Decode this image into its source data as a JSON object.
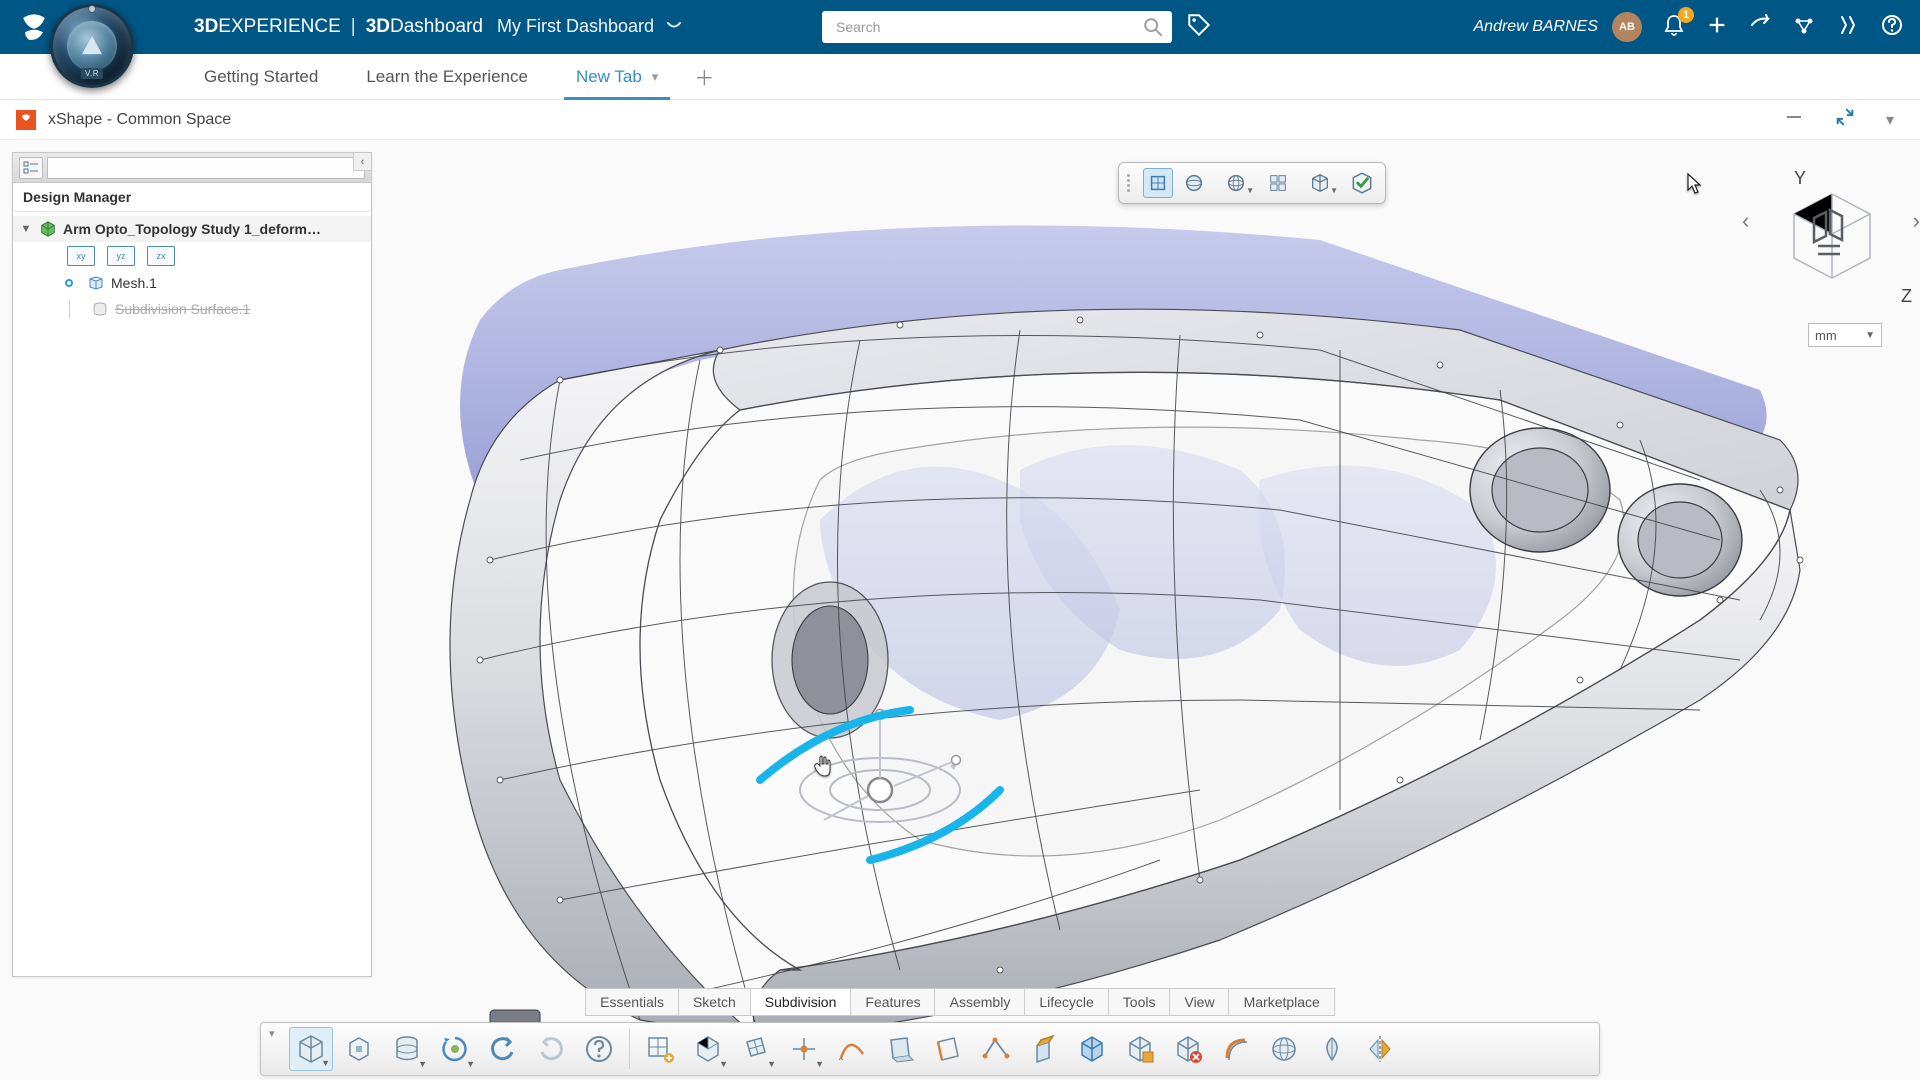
{
  "topbar": {
    "brand_prefix": "3D",
    "brand_exp": "EXPERIENCE",
    "brand_dash_prefix": "3D",
    "brand_dash": "Dashboard",
    "dashboard_title": "My First Dashboard",
    "search_placeholder": "Search",
    "user_name": "Andrew BARNES",
    "user_initials": "AB",
    "notification_count": "1",
    "compass_label": "V.R"
  },
  "tabs": [
    {
      "label": "Getting Started",
      "active": false
    },
    {
      "label": "Learn the Experience",
      "active": false
    },
    {
      "label": "New Tab",
      "active": true
    }
  ],
  "app": {
    "title": "xShape - Common Space"
  },
  "design_manager": {
    "title": "Design Manager",
    "root_label": "Arm Opto_Topology Study 1_deform…",
    "planes": [
      "xy",
      "yz",
      "zx"
    ],
    "children": [
      {
        "label": "Mesh.1",
        "icon": "mesh",
        "active_dot": true,
        "disabled": false
      },
      {
        "label": "Subdivision Surface.1",
        "icon": "subd",
        "active_dot": false,
        "disabled": true
      }
    ]
  },
  "float_toolbar": {
    "items": [
      {
        "name": "box-mode",
        "active": true
      },
      {
        "name": "sphere-mode",
        "active": false
      },
      {
        "name": "globe-mode",
        "active": false,
        "dropdown": true
      },
      {
        "name": "settings-mode",
        "active": false
      },
      {
        "name": "cube-view",
        "active": false,
        "dropdown": true
      },
      {
        "name": "confirm",
        "active": false
      }
    ]
  },
  "view": {
    "axis_y": "Y",
    "axis_z": "Z",
    "nav_left": "‹",
    "nav_right": "›",
    "unit": "mm"
  },
  "category_tabs": [
    "Essentials",
    "Sketch",
    "Subdivision",
    "Features",
    "Assembly",
    "Lifecycle",
    "Tools",
    "View",
    "Marketplace"
  ],
  "category_active_index": 2,
  "bottom_tools": {
    "group1": [
      {
        "name": "primitive-box",
        "dropdown": true,
        "active": true
      },
      {
        "name": "import",
        "dropdown": false
      },
      {
        "name": "database",
        "dropdown": true
      },
      {
        "name": "cycle",
        "dropdown": true
      },
      {
        "name": "undo"
      },
      {
        "name": "redo"
      },
      {
        "name": "help"
      }
    ],
    "group2": [
      {
        "name": "grid-add"
      },
      {
        "name": "primitive-shape",
        "dropdown": true
      },
      {
        "name": "grid-face",
        "dropdown": true
      },
      {
        "name": "point",
        "dropdown": true
      },
      {
        "name": "curve"
      },
      {
        "name": "face-select"
      },
      {
        "name": "edge-select"
      },
      {
        "name": "edge-modify"
      },
      {
        "name": "extrude"
      },
      {
        "name": "box-blue"
      },
      {
        "name": "box-orange"
      },
      {
        "name": "box-delete"
      },
      {
        "name": "bend"
      },
      {
        "name": "sphere-tool"
      },
      {
        "name": "leaf-tool"
      },
      {
        "name": "mirror"
      }
    ]
  }
}
